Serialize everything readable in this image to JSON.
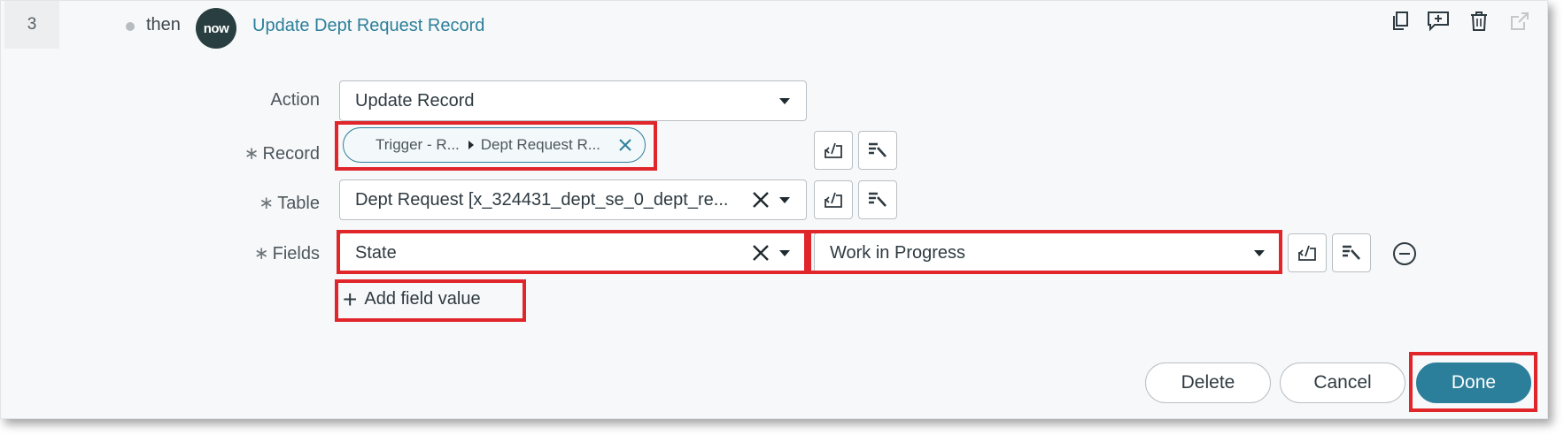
{
  "step": {
    "number": "3",
    "connector": "then",
    "logo_text": "now",
    "title": "Update Dept Request Record"
  },
  "toolbar_icons": [
    "copy-icon",
    "add-comment-icon",
    "delete-icon",
    "open-external-icon"
  ],
  "form": {
    "action": {
      "label": "Action",
      "value": "Update Record"
    },
    "record": {
      "label": "Record",
      "required_mark": "∗",
      "pill_part1": "Trigger - R...",
      "pill_part2": "Dept Request R..."
    },
    "table": {
      "label": "Table",
      "required_mark": "∗",
      "value": "Dept Request [x_324431_dept_se_0_dept_re..."
    },
    "fields": {
      "label": "Fields",
      "required_mark": "∗",
      "field_name": "State",
      "field_value": "Work in Progress"
    },
    "add_field_label": "Add field value"
  },
  "buttons": {
    "delete": "Delete",
    "cancel": "Cancel",
    "done": "Done"
  },
  "colors": {
    "accent": "#2c7f9b",
    "highlight": "#e0262b",
    "logo_bg": "#293e40"
  }
}
